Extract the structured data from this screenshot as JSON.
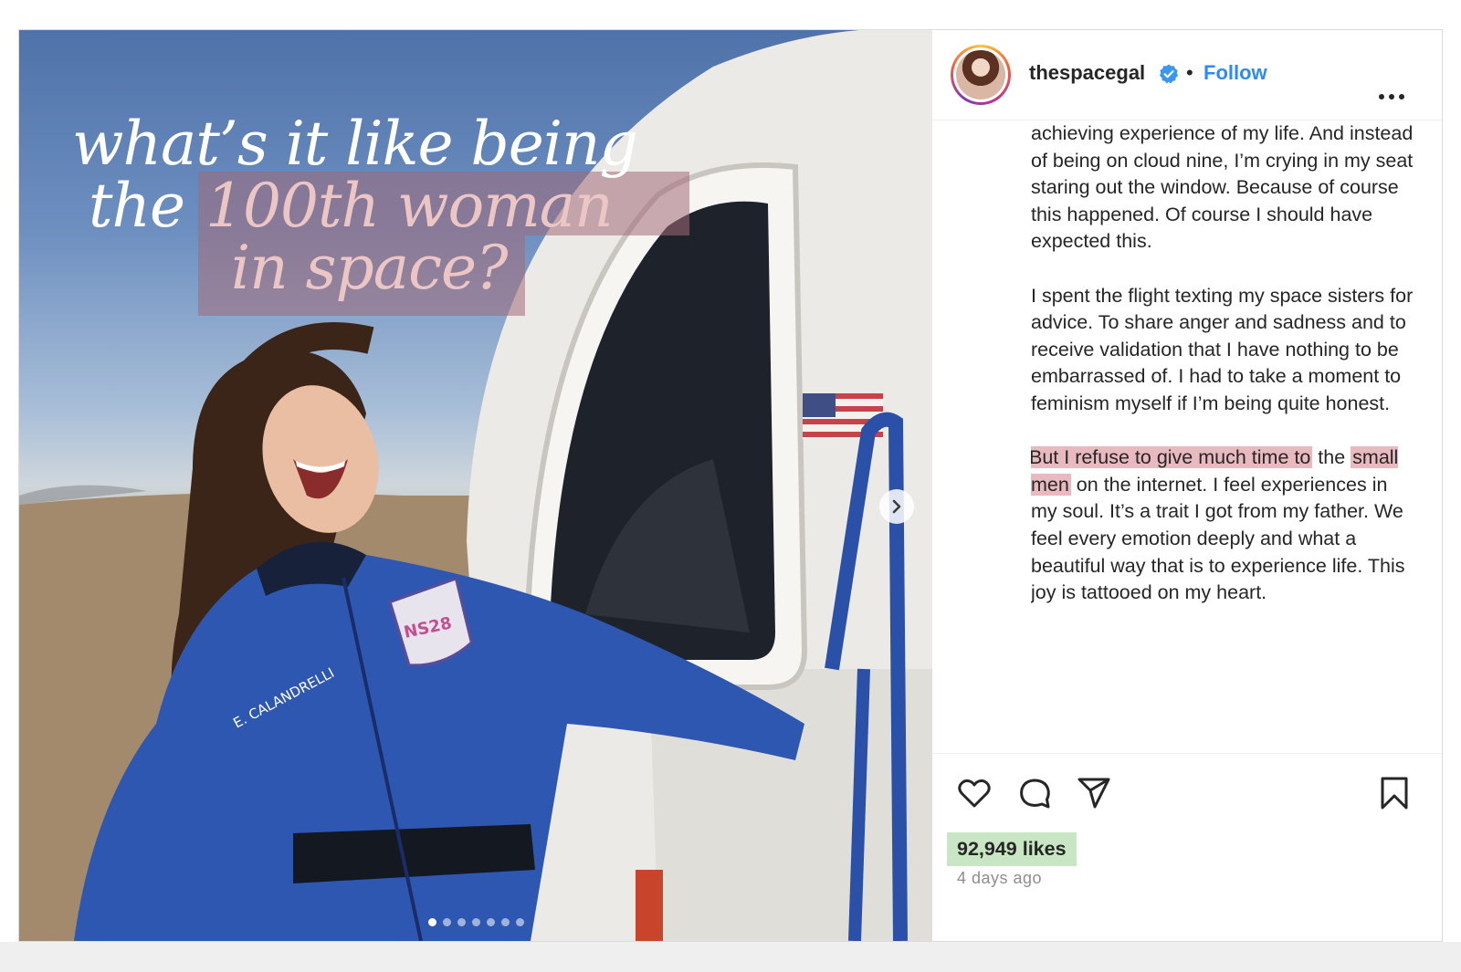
{
  "post": {
    "media": {
      "headline": {
        "line1": "what’s it like being",
        "line2_plain": "the",
        "line2_highlight": "100th woman",
        "line3_highlight": "in space?"
      },
      "suit_name": "E. CALANDRELLI",
      "patch_text": "NS28",
      "carousel": {
        "total": 7,
        "active_index": 0
      }
    },
    "author": {
      "username": "thespacegal",
      "verified": true,
      "separator": "•",
      "follow_label": "Follow"
    },
    "caption": {
      "p1": "achieving experience of my life. And instead of being on cloud nine, I’m crying in my seat staring out the window. Because of course this happened. Of course I should have expected this.",
      "p2": "I spent the flight texting my space sisters for advice. To share anger and sadness and to receive validation that I have nothing to be embarrassed of. I had to take a moment to feminism myself if I’m being quite honest.",
      "p3_mark1": "But I refuse to give much time to",
      "p3_text1": " the ",
      "p3_mark2": "small men",
      "p3_text2": " on the internet. I feel experiences in my soul. It’s a trait I got from my father. We feel every emotion deeply and what a beautiful way that is to experience life. This joy is tattooed on my heart."
    },
    "actions": {
      "icons": [
        "heart-icon",
        "comment-icon",
        "share-icon",
        "bookmark-icon"
      ]
    },
    "likes": "92,949 likes",
    "timestamp": "4 days ago"
  },
  "colors": {
    "link": "#2f8bf4",
    "highlight_pink": "#e8b9be",
    "highlight_green": "#c8e6c3",
    "verified": "#3897f0"
  }
}
